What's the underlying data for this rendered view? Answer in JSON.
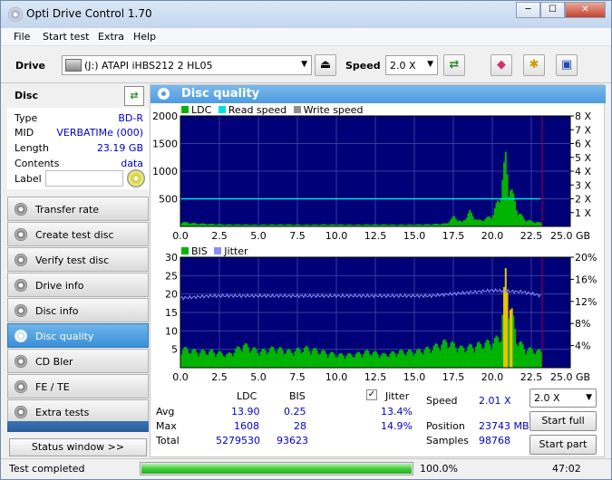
{
  "window": {
    "title": "Opti Drive Control 1.70",
    "min": "─",
    "max": "☐",
    "close": "✕"
  },
  "menu": [
    "File",
    "Start test",
    "Extra",
    "Help"
  ],
  "toolbar": {
    "drive_label": "Drive",
    "drive_value": "(J:)   ATAPI iHBS212   2 HL05",
    "speed_label": "Speed",
    "speed_value": "2.0 X"
  },
  "disc": {
    "header": "Disc",
    "rows": [
      {
        "k": "Type",
        "v": "BD-R"
      },
      {
        "k": "MID",
        "v": "VERBATIMe (000)"
      },
      {
        "k": "Length",
        "v": "23.19 GB"
      },
      {
        "k": "Contents",
        "v": "data"
      }
    ],
    "label_key": "Label",
    "label_value": ""
  },
  "nav": [
    "Transfer rate",
    "Create test disc",
    "Verify test disc",
    "Drive info",
    "Disc info",
    "Disc quality",
    "CD Bler",
    "FE / TE",
    "Extra tests"
  ],
  "nav_active": "Disc quality",
  "status_window_btn": "Status window >>",
  "panel_title": "Disc quality",
  "legend_top": [
    "LDC",
    "Read speed",
    "Write speed"
  ],
  "legend_bottom": [
    "BIS",
    "Jitter"
  ],
  "colors": {
    "ldc": "#00b400",
    "read": "#00e0e0",
    "write": "#909090",
    "bis": "#00b400",
    "jitter": "#8c8cff",
    "plot_bg": "#000078",
    "grid": "#3a3aa0",
    "peak": "#e8c400",
    "stats_blue": "#0000c8"
  },
  "chart_data": [
    {
      "type": "bar",
      "x_range": [
        0,
        25
      ],
      "x_ticks": [
        "0.0",
        "2.5",
        "5.0",
        "7.5",
        "10.0",
        "12.5",
        "15.0",
        "17.5",
        "20.0",
        "22.5",
        "25.0 GB"
      ],
      "y_left_ticks": [
        "2000",
        "1500",
        "1000",
        "500"
      ],
      "y_left_range": [
        0,
        2000
      ],
      "y_right_ticks": [
        "8 X",
        "7 X",
        "6 X",
        "5 X",
        "4 X",
        "3 X",
        "2 X",
        "1 X"
      ],
      "y_right_range": [
        0,
        8
      ],
      "series": [
        {
          "name": "LDC",
          "x": [
            0,
            1,
            2,
            3,
            4,
            5,
            6,
            7,
            8,
            9,
            10,
            11,
            12,
            13,
            14,
            15,
            16,
            17,
            17.5,
            18,
            18.5,
            19,
            19.5,
            20,
            20.5,
            20.8,
            21,
            21.3,
            21.6,
            22,
            22.5,
            23,
            23.2
          ],
          "values": [
            90,
            60,
            50,
            40,
            40,
            35,
            40,
            40,
            35,
            40,
            40,
            35,
            40,
            40,
            35,
            40,
            45,
            60,
            200,
            80,
            300,
            120,
            150,
            250,
            700,
            1400,
            900,
            600,
            300,
            150,
            100,
            80,
            60
          ]
        },
        {
          "name": "Read speed",
          "x": [
            0,
            23.2
          ],
          "values": [
            2.0,
            2.0
          ]
        }
      ],
      "end_marker": 23.2
    },
    {
      "type": "bar",
      "x_range": [
        0,
        25
      ],
      "x_ticks": [
        "0.0",
        "2.5",
        "5.0",
        "7.5",
        "10.0",
        "12.5",
        "15.0",
        "17.5",
        "20.0",
        "22.5",
        "25.0 GB"
      ],
      "y_left_ticks": [
        "30",
        "25",
        "20",
        "15",
        "10",
        "5"
      ],
      "y_left_range": [
        0,
        30
      ],
      "y_right_ticks": [
        "20%",
        "16%",
        "12%",
        "8%",
        "4%"
      ],
      "y_right_range": [
        0,
        20
      ],
      "series": [
        {
          "name": "BIS",
          "x": [
            0,
            1,
            2,
            3,
            4,
            5,
            6,
            7,
            8,
            9,
            10,
            11,
            12,
            13,
            14,
            15,
            16,
            17,
            18,
            19,
            20,
            20.5,
            20.8,
            21,
            21.5,
            22,
            23
          ],
          "values": [
            6,
            5,
            5,
            4,
            7,
            5,
            6,
            5,
            6,
            5,
            4,
            4,
            5,
            4,
            5,
            5,
            6,
            8,
            6,
            7,
            8,
            10,
            28,
            22,
            9,
            6,
            5
          ]
        },
        {
          "name": "Jitter",
          "x": [
            0,
            2,
            4,
            6,
            8,
            10,
            12,
            14,
            16,
            18,
            20,
            22,
            23.2
          ],
          "values": [
            12.6,
            13.0,
            13.0,
            13.0,
            13.0,
            13.0,
            13.0,
            13.0,
            13.0,
            13.5,
            14.0,
            13.7,
            13.0
          ]
        }
      ],
      "end_marker": 23.2
    }
  ],
  "stats": {
    "col_ldc": "LDC",
    "col_bis": "BIS",
    "col_jitter": "Jitter",
    "rows": [
      {
        "k": "Avg",
        "ldc": "13.90",
        "bis": "0.25",
        "jitter": "13.4%"
      },
      {
        "k": "Max",
        "ldc": "1608",
        "bis": "28",
        "jitter": "14.9%"
      },
      {
        "k": "Total",
        "ldc": "5279530",
        "bis": "93623",
        "jitter": ""
      }
    ],
    "speed_label": "Speed",
    "speed_value": "2.01 X",
    "position_label": "Position",
    "position_value": "23743 MB",
    "samples_label": "Samples",
    "samples_value": "98768",
    "speed_select": "2.0 X",
    "start_full": "Start full",
    "start_part": "Start part"
  },
  "status": {
    "text": "Test completed",
    "progress": 1.0,
    "progress_text": "100.0%",
    "time": "47:02"
  }
}
